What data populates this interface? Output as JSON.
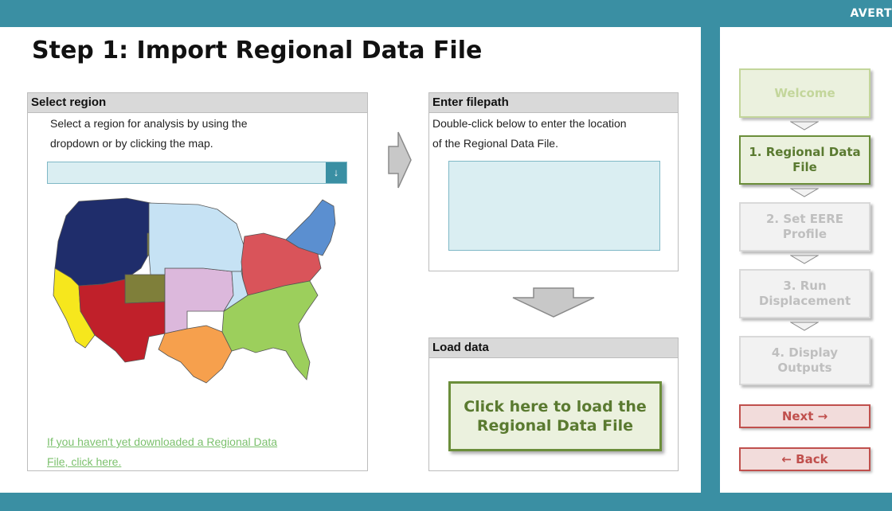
{
  "app": {
    "brand": "AVERT"
  },
  "page": {
    "title": "Step 1: Import Regional Data File"
  },
  "select_region": {
    "header": "Select region",
    "instructions_line1": "Select a region for analysis by using the",
    "instructions_line2": "dropdown or by clicking the map.",
    "dropdown_value": "",
    "dropdown_icon": "arrow-down-icon",
    "download_link_line1": "If you haven't yet downloaded a Regional Data",
    "download_link_line2": "File, click here."
  },
  "filepath": {
    "header": "Enter filepath",
    "instructions_line1": "Double-click below to enter the location",
    "instructions_line2": "of the Regional Data File.",
    "value": ""
  },
  "load_data": {
    "header": "Load data",
    "button_line1": "Click here to load the",
    "button_line2": "Regional Data File"
  },
  "nav": {
    "steps": [
      {
        "label": "Welcome",
        "state": "done"
      },
      {
        "label_line1": "1. Regional Data",
        "label_line2": "File",
        "state": "active"
      },
      {
        "label_line1": "2. Set EERE",
        "label_line2": "Profile",
        "state": "disabled"
      },
      {
        "label_line1": "3. Run",
        "label_line2": "Displacement",
        "state": "disabled"
      },
      {
        "label_line1": "4. Display",
        "label_line2": "Outputs",
        "state": "disabled"
      }
    ],
    "next_label": "Next →",
    "back_label": "← Back"
  },
  "colors": {
    "accent": "#3a8fa3",
    "active_green": "#6b8e3a",
    "nav_red": "#c0504d",
    "input_fill": "#daeef2"
  }
}
